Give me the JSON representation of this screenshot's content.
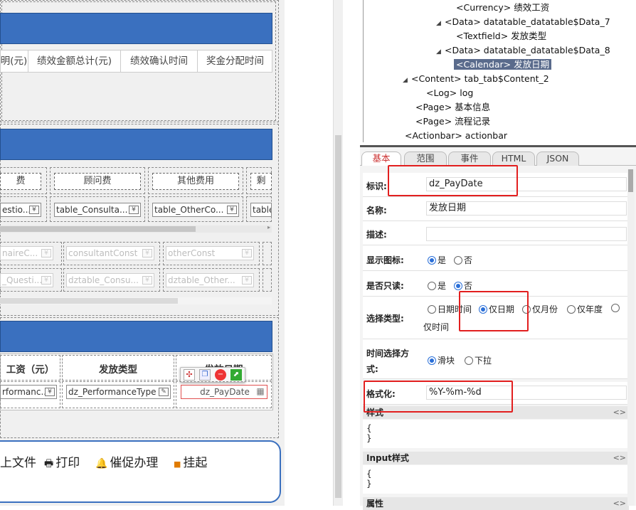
{
  "designer": {
    "table1_headers": [
      "明(元)",
      "绩效金额总计(元)",
      "绩效确认时间",
      "奖金分配时间"
    ],
    "table2_labels": [
      "费",
      "顾问费",
      "其他费用",
      "剩"
    ],
    "table2_fields": [
      "estio...",
      "table_Consulta...",
      "table_OtherCo...",
      "table"
    ],
    "table2_fields2": [
      "naireC...",
      "consultantConst",
      "otherConst",
      ""
    ],
    "table2_fields3": [
      "_Questi...",
      "dztable_Consu...",
      "dztable_Other...",
      ""
    ],
    "table3_headers": [
      "工资（元）",
      "发放类型",
      "发放日期"
    ],
    "table3_fields": [
      "rformanc...",
      "dz_PerformanceType",
      "dz_PayDate"
    ],
    "actionbar": [
      "上文件",
      "打印",
      "催促办理",
      "挂起"
    ]
  },
  "tree": {
    "nodes": [
      {
        "text": "<Currency> 绩效工资",
        "arrow": ""
      },
      {
        "text": "<Data> datatable_datatable$Data_7",
        "arrow": "◢"
      },
      {
        "text": "<Textfield> 发放类型",
        "arrow": ""
      },
      {
        "text": "<Data> datatable_datatable$Data_8",
        "arrow": "◢"
      },
      {
        "text": "<Calendar> 发放日期",
        "arrow": ""
      },
      {
        "text": "<Content> tab_tab$Content_2",
        "arrow": "◢"
      },
      {
        "text": "<Log> log",
        "arrow": ""
      },
      {
        "text": "<Page> 基本信息",
        "arrow": ""
      },
      {
        "text": "<Page> 流程记录",
        "arrow": ""
      },
      {
        "text": "<Actionbar> actionbar",
        "arrow": ""
      }
    ]
  },
  "props": {
    "tabs": [
      "基本",
      "范围",
      "事件",
      "HTML",
      "JSON"
    ],
    "id_label": "标识:",
    "id_value": "dz_PayDate",
    "name_label": "名称:",
    "name_value": "发放日期",
    "desc_label": "描述:",
    "desc_value": "",
    "showicon_label": "显示图标:",
    "yes": "是",
    "no": "否",
    "readonly_label": "是否只读:",
    "seltype_label": "选择类型:",
    "seltype_opts": [
      "日期时间",
      "仅日期",
      "仅月份",
      "仅年度",
      "仅时间"
    ],
    "timemode_label": "时间选择方式:",
    "timemode_opts": [
      "滑块",
      "下拉"
    ],
    "format_label": "格式化:",
    "format_value": "%Y-%m-%d",
    "style_label": "样式",
    "style_body": [
      "{",
      "}"
    ],
    "input_style_label": "Input样式",
    "input_style_body": [
      "{",
      "}"
    ],
    "attr_label": "属性",
    "toggle": "<>"
  }
}
